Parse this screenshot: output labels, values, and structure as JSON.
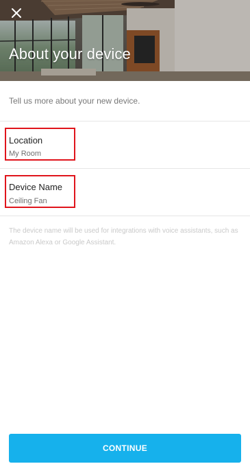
{
  "header": {
    "title": "About your device",
    "close_icon": "close-icon"
  },
  "intro": "Tell us more about your new device.",
  "fields": [
    {
      "label": "Location",
      "value": "My Room"
    },
    {
      "label": "Device Name",
      "value": "Ceiling Fan"
    }
  ],
  "note": "The device name will be used for integrations with voice assistants, such as Amazon Alexa or Google Assistant.",
  "continue_label": "CONTINUE",
  "colors": {
    "accent": "#16b1ec",
    "highlight_border": "#e0141b"
  }
}
